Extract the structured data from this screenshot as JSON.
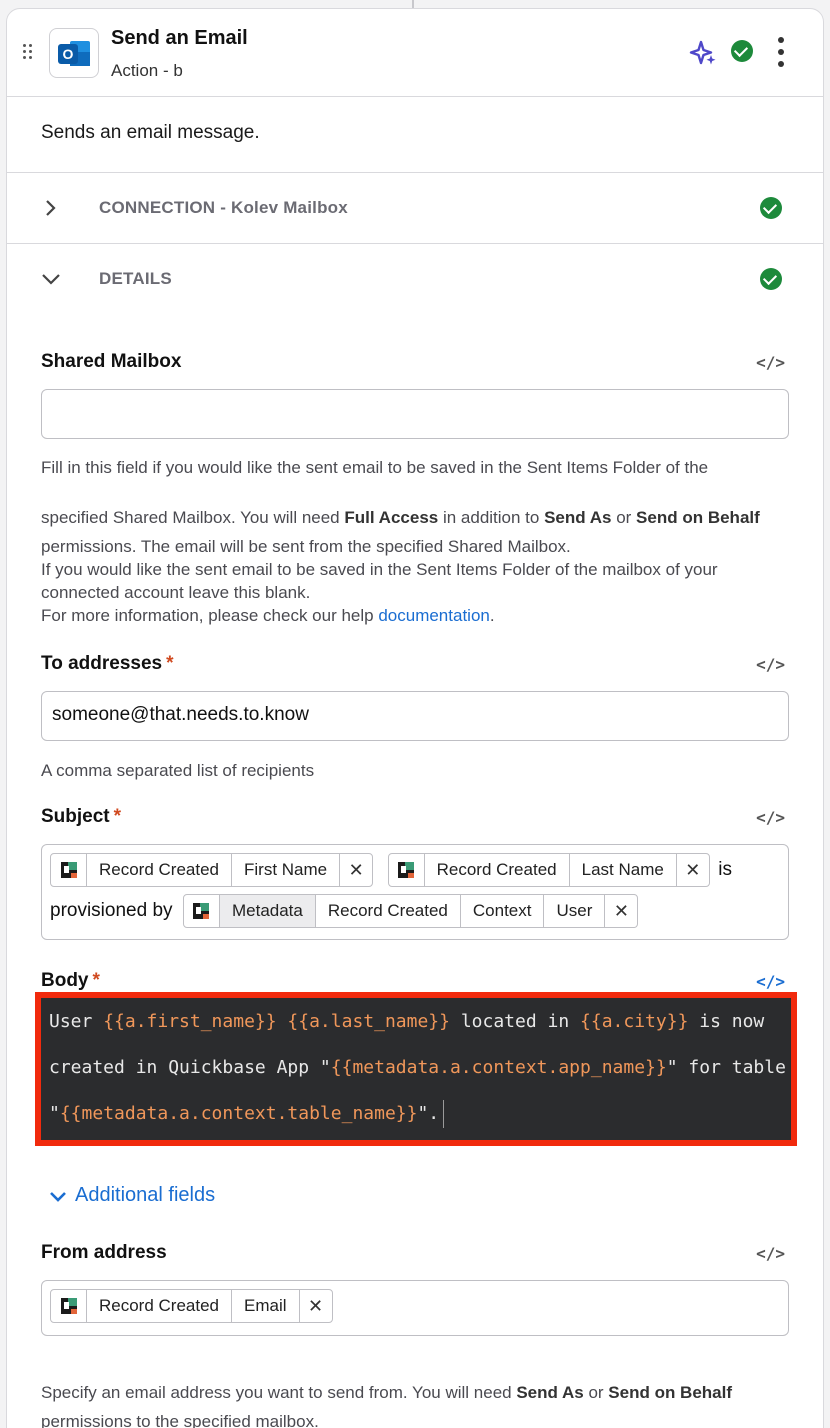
{
  "header": {
    "title": "Send an Email",
    "subtitle": "Action - b"
  },
  "description": "Sends an email message.",
  "sections": {
    "connection_label": "CONNECTION - Kolev Mailbox",
    "details_label": "DETAILS"
  },
  "shared_mailbox": {
    "label": "Shared Mailbox",
    "value": "",
    "help_line1": "Fill in this field if you would like the sent email to be saved in the Sent Items Folder of the",
    "help_line2_a": "specified Shared Mailbox. You will need ",
    "help_line2_b": "Full Access",
    "help_line2_c": " in addition to ",
    "help_line2_d": "Send As",
    "help_line2_e": " or ",
    "help_line2_f": "Send on Behalf",
    "help_line3": "permissions. The email will be sent from the specified Shared Mailbox.",
    "help_line4": "If you would like the sent email to be saved in the Sent Items Folder of the mailbox of your",
    "help_line5": "connected account leave this blank.",
    "help_line6_a": "For more information, please check our help ",
    "help_line6_link": "documentation",
    "help_line6_b": "."
  },
  "to_addresses": {
    "label": "To addresses",
    "required": "*",
    "value": "someone@that.needs.to.know",
    "help": "A comma separated list of recipients"
  },
  "subject": {
    "label": "Subject",
    "required": "*",
    "pill1": [
      "Record Created",
      "First Name"
    ],
    "pill2": [
      "Record Created",
      "Last Name"
    ],
    "text1": "is",
    "text2": "provisioned by",
    "pill3": [
      "Metadata",
      "Record Created",
      "Context",
      "User"
    ]
  },
  "body": {
    "label": "Body",
    "required": "*",
    "line1": [
      "User ",
      "{{a.first_name}}",
      " ",
      "{{a.last_name}}",
      " located in ",
      "{{a.city}}",
      " is now"
    ],
    "line2": [
      "created in Quickbase App \"",
      "{{metadata.a.context.app_name}}",
      "\" for table"
    ],
    "line3": [
      "\"",
      "{{metadata.a.context.table_name}}",
      "\"."
    ]
  },
  "additional_fields_label": "Additional fields",
  "from_address": {
    "label": "From address",
    "pill": [
      "Record Created",
      "Email"
    ],
    "help_a": "Specify an email address you want to send from. You will need ",
    "help_b": "Send As",
    "help_c": " or ",
    "help_d": "Send on Behalf",
    "help_e": "permissions to the specified mailbox."
  },
  "code_icon": "</>",
  "icons": [
    "drag-handle-icon",
    "outlook-icon",
    "ai-sparkle-icon",
    "check-circle-icon",
    "more-vertical-icon",
    "chevron-right-icon",
    "chevron-down-icon",
    "quickbase-icon",
    "close-icon"
  ],
  "colors": {
    "accent": "#1a6dd1",
    "success": "#1d8a3b",
    "required": "#d04a20",
    "highlight": "#f12a0d",
    "editor_bg": "#2b2c2e",
    "token": "#f0975a"
  }
}
